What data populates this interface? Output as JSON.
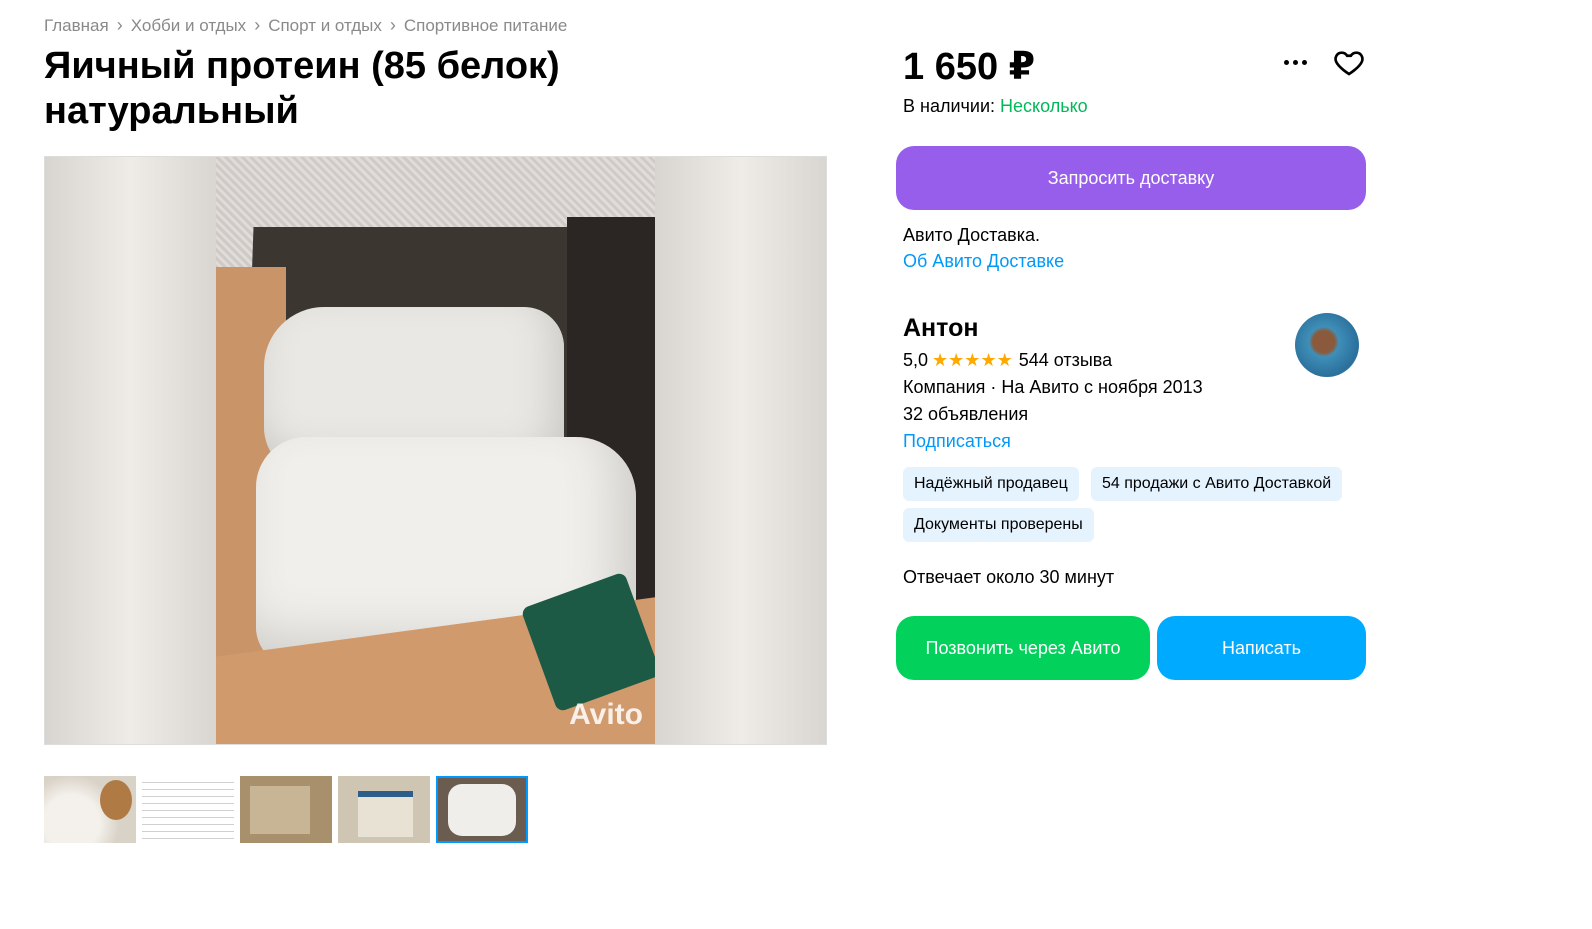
{
  "breadcrumbs": [
    "Главная",
    "Хобби и отдых",
    "Спорт и отдых",
    "Спортивное питание"
  ],
  "title": "Яичный протеин (85 белок) натуральный",
  "gallery": {
    "watermark": "Avito",
    "thumbnail_count": 5,
    "active_thumbnail": 5
  },
  "price": "1 650 ₽",
  "availability": {
    "label": "В наличии: ",
    "value": "Несколько",
    "value_color": "#02b85a"
  },
  "delivery": {
    "button_label": "Запросить доставку",
    "button_color": "#965eeb",
    "text": "Авито Доставка.",
    "link": "Об Авито Доставке"
  },
  "seller": {
    "name": "Антон",
    "rating": "5,0",
    "stars": "★★★★★",
    "reviews": "544 отзыва",
    "info": "Компания · На Авито с ноября 2013",
    "ads": "32 объявления",
    "subscribe": "Подписаться",
    "badges": [
      "Надёжный продавец",
      "54 продажи с Авито Доставкой",
      "Документы проверены"
    ],
    "response_time": "Отвечает около 30 минут"
  },
  "actions": {
    "call_label": "Позвонить через Авито",
    "write_label": "Написать",
    "call_color": "#02d15c",
    "write_color": "#00aaff"
  },
  "icons": {
    "more": "more-dots-icon",
    "favorite": "heart-icon",
    "breadcrumb_separator": "chevron-right-icon"
  }
}
